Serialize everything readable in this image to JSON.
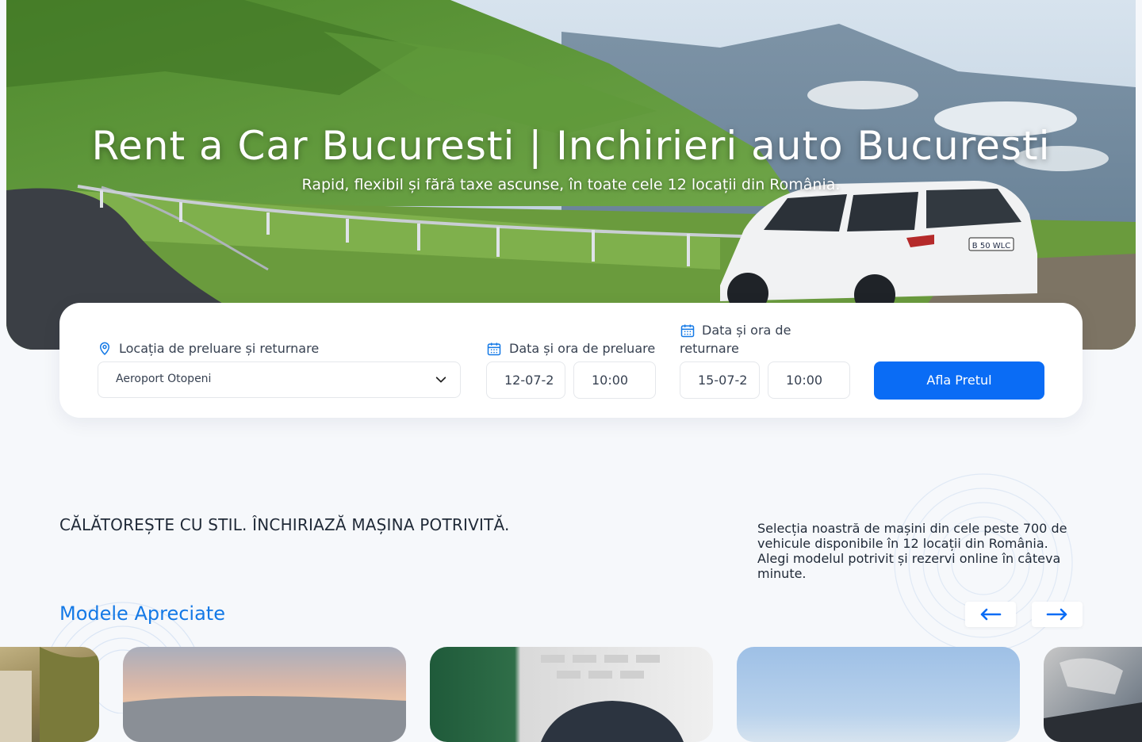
{
  "hero": {
    "title": "Rent a Car Bucuresti | Inchirieri auto Bucuresti",
    "subtitle": "Rapid, flexibil și fără taxe ascunse, în toate cele 12 locații din România.",
    "plate": "B 50 WLC"
  },
  "search": {
    "location_label": "Locația de preluare și returnare",
    "location_value": "Aeroport Otopeni",
    "pickup_label": "Data și ora de preluare",
    "pickup_date": "12-07-2",
    "pickup_time": "10:00",
    "return_label": "Data și ora de returnare",
    "return_date": "15-07-2",
    "return_time": "10:00",
    "submit_label": "Afla Pretul"
  },
  "section": {
    "tagline": "CĂLĂTOREȘTE CU STIL. ÎNCHIRIAZĂ MAȘINA POTRIVITĂ.",
    "description": "Selecția noastră de mașini din cele peste 700 de vehicule disponibile în 12 locații din România. Alegi modelul potrivit și rezervi online în câteva minute.",
    "featured_title": "Modele Apreciate"
  },
  "colors": {
    "accent": "#0a6cf5",
    "title_blue": "#1479e6",
    "background": "#f6f8fb"
  },
  "icons": {
    "location": "map-pin-icon",
    "date": "calendar-icon",
    "dropdown": "chevron-down-icon",
    "prev": "arrow-left-icon",
    "next": "arrow-right-icon"
  }
}
